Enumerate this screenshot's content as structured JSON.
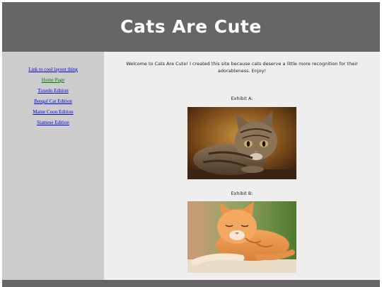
{
  "header": {
    "title": "Cats Are Cute"
  },
  "sidebar": {
    "links": [
      {
        "label": "Link to cool layout thing",
        "current": false
      },
      {
        "label": "Home Page",
        "current": true
      },
      {
        "label": "Tuxedo Edition",
        "current": false
      },
      {
        "label": "Bengal Cat Edition",
        "current": false
      },
      {
        "label": "Maine Coon Edition",
        "current": false
      },
      {
        "label": "Siamese Edition",
        "current": false
      }
    ]
  },
  "main": {
    "intro": "Welcome to Cats Are Cute! I created this site because cats deserve a little more recognition for their adorableness. Enjoy!",
    "exhibits": [
      {
        "label": "Exhibit A:",
        "image": "tabby-cat-photo"
      },
      {
        "label": "Exhibit B:",
        "image": "orange-cat-photo"
      }
    ]
  },
  "colors": {
    "header_bg": "#666666",
    "sidebar_bg": "#cccccc",
    "content_bg": "#eeeeee",
    "link": "#0000ee",
    "current_link": "#008000"
  }
}
